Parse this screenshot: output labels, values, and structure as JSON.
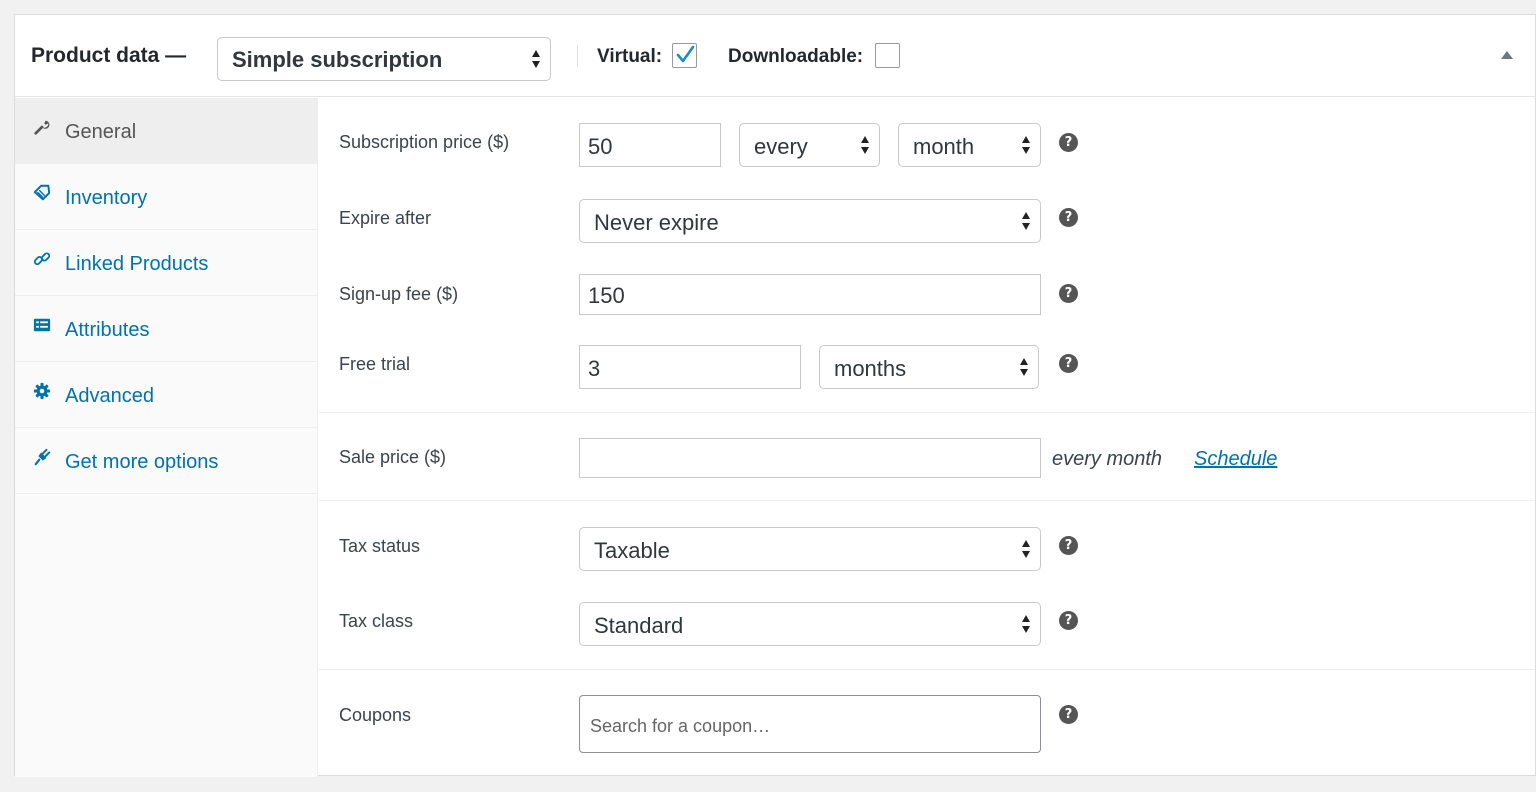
{
  "header": {
    "title": "Product data —",
    "product_type": "Simple subscription",
    "virtual_label": "Virtual:",
    "virtual_checked": true,
    "downloadable_label": "Downloadable:",
    "downloadable_checked": false
  },
  "tabs": [
    {
      "label": "General",
      "icon": "wrench-icon",
      "active": true
    },
    {
      "label": "Inventory",
      "icon": "tag-icon",
      "active": false
    },
    {
      "label": "Linked Products",
      "icon": "link-icon",
      "active": false
    },
    {
      "label": "Attributes",
      "icon": "list-card-icon",
      "active": false
    },
    {
      "label": "Advanced",
      "icon": "gear-icon",
      "active": false
    },
    {
      "label": "Get more options",
      "icon": "plugin-icon",
      "active": false
    }
  ],
  "fields": {
    "subscription_price": {
      "label": "Subscription price ($)",
      "value": "50",
      "interval": "every",
      "period": "month"
    },
    "expire_after": {
      "label": "Expire after",
      "value": "Never expire"
    },
    "signup_fee": {
      "label": "Sign-up fee ($)",
      "value": "150"
    },
    "free_trial": {
      "label": "Free trial",
      "value": "3",
      "period": "months"
    },
    "sale_price": {
      "label": "Sale price ($)",
      "value": "",
      "suffix": "every month",
      "schedule_link": "Schedule"
    },
    "tax_status": {
      "label": "Tax status",
      "value": "Taxable"
    },
    "tax_class": {
      "label": "Tax class",
      "value": "Standard"
    },
    "coupons": {
      "label": "Coupons",
      "placeholder": "Search for a coupon…"
    }
  },
  "colors": {
    "link": "#0073aa",
    "help_icon": "#555555",
    "active_tab_bg": "#eeeeee"
  }
}
